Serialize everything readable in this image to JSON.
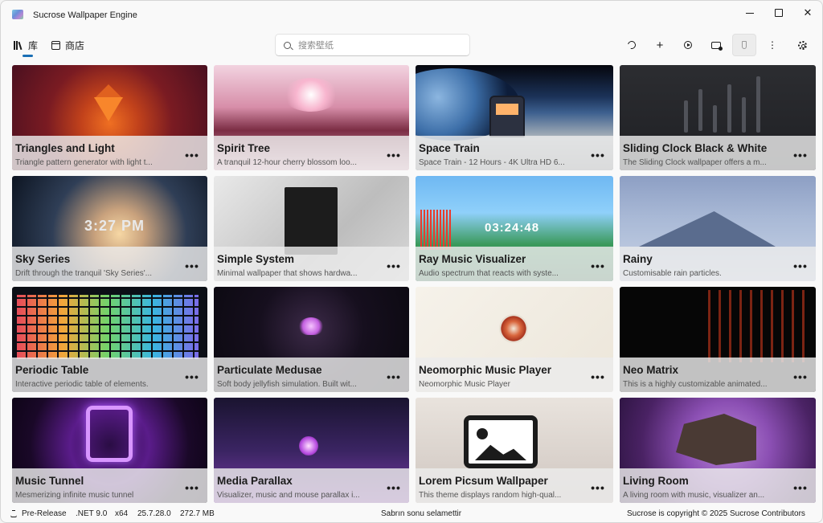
{
  "window": {
    "title": "Sucrose Wallpaper Engine",
    "minimize_glyph": "",
    "close_glyph": "✕"
  },
  "nav": {
    "library_label": "库",
    "store_label": "商店",
    "library_icon": "books-icon",
    "store_icon": "store-icon"
  },
  "search": {
    "placeholder": "搜索壁纸",
    "value": ""
  },
  "toolbar": {
    "add_glyph": "+",
    "more_glyph": "⋮",
    "icons": [
      "history-icon",
      "add-icon",
      "play-icon",
      "screen-icon",
      "brush-icon",
      "more-icon",
      "settings-icon"
    ]
  },
  "wallpapers": [
    {
      "title": "Triangles and Light",
      "description": "Triangle pattern generator with light t..."
    },
    {
      "title": "Spirit Tree",
      "description": "A tranquil 12-hour cherry blossom loo..."
    },
    {
      "title": "Space Train",
      "description": "Space Train - 12 Hours - 4K Ultra HD 6..."
    },
    {
      "title": "Sliding Clock Black & White",
      "description": "The Sliding Clock wallpaper offers a m..."
    },
    {
      "title": "Sky Series",
      "description": "Drift through the tranquil 'Sky Series'..."
    },
    {
      "title": "Simple System",
      "description": "Minimal wallpaper that shows hardwa..."
    },
    {
      "title": "Ray Music Visualizer",
      "description": "Audio spectrum that reacts with syste..."
    },
    {
      "title": "Rainy",
      "description": "Customisable rain particles."
    },
    {
      "title": "Periodic Table",
      "description": "Interactive periodic table of elements."
    },
    {
      "title": "Particulate Medusae",
      "description": "Soft body jellyfish simulation. Built wit..."
    },
    {
      "title": "Neomorphic Music Player",
      "description": "Neomorphic Music Player"
    },
    {
      "title": "Neo Matrix",
      "description": "This is a highly customizable animated..."
    },
    {
      "title": "Music Tunnel",
      "description": "Mesmerizing infinite music tunnel"
    },
    {
      "title": "Media Parallax",
      "description": "Visualizer, music and mouse parallax i..."
    },
    {
      "title": "Lorem Picsum Wallpaper",
      "description": "This theme displays random high-qual..."
    },
    {
      "title": "Living Room",
      "description": "A living room with music, visualizer an..."
    }
  ],
  "card_more_glyph": "•••",
  "thumb_text": {
    "sky_clock": "3:27 PM",
    "ray_time": "03:24:48"
  },
  "status": {
    "release": "Pre-Release",
    "framework": ".NET 9.0",
    "arch": "x64",
    "version": "25.7.28.0",
    "memory": "272.7 MB",
    "message": "Sabrın sonu selamettir",
    "copyright": "Sucrose is copyright © 2025 Sucrose Contributors"
  },
  "colors": {
    "accent": "#1a6fb5",
    "background": "#f9f9f9",
    "card_overlay": "#ececec"
  }
}
